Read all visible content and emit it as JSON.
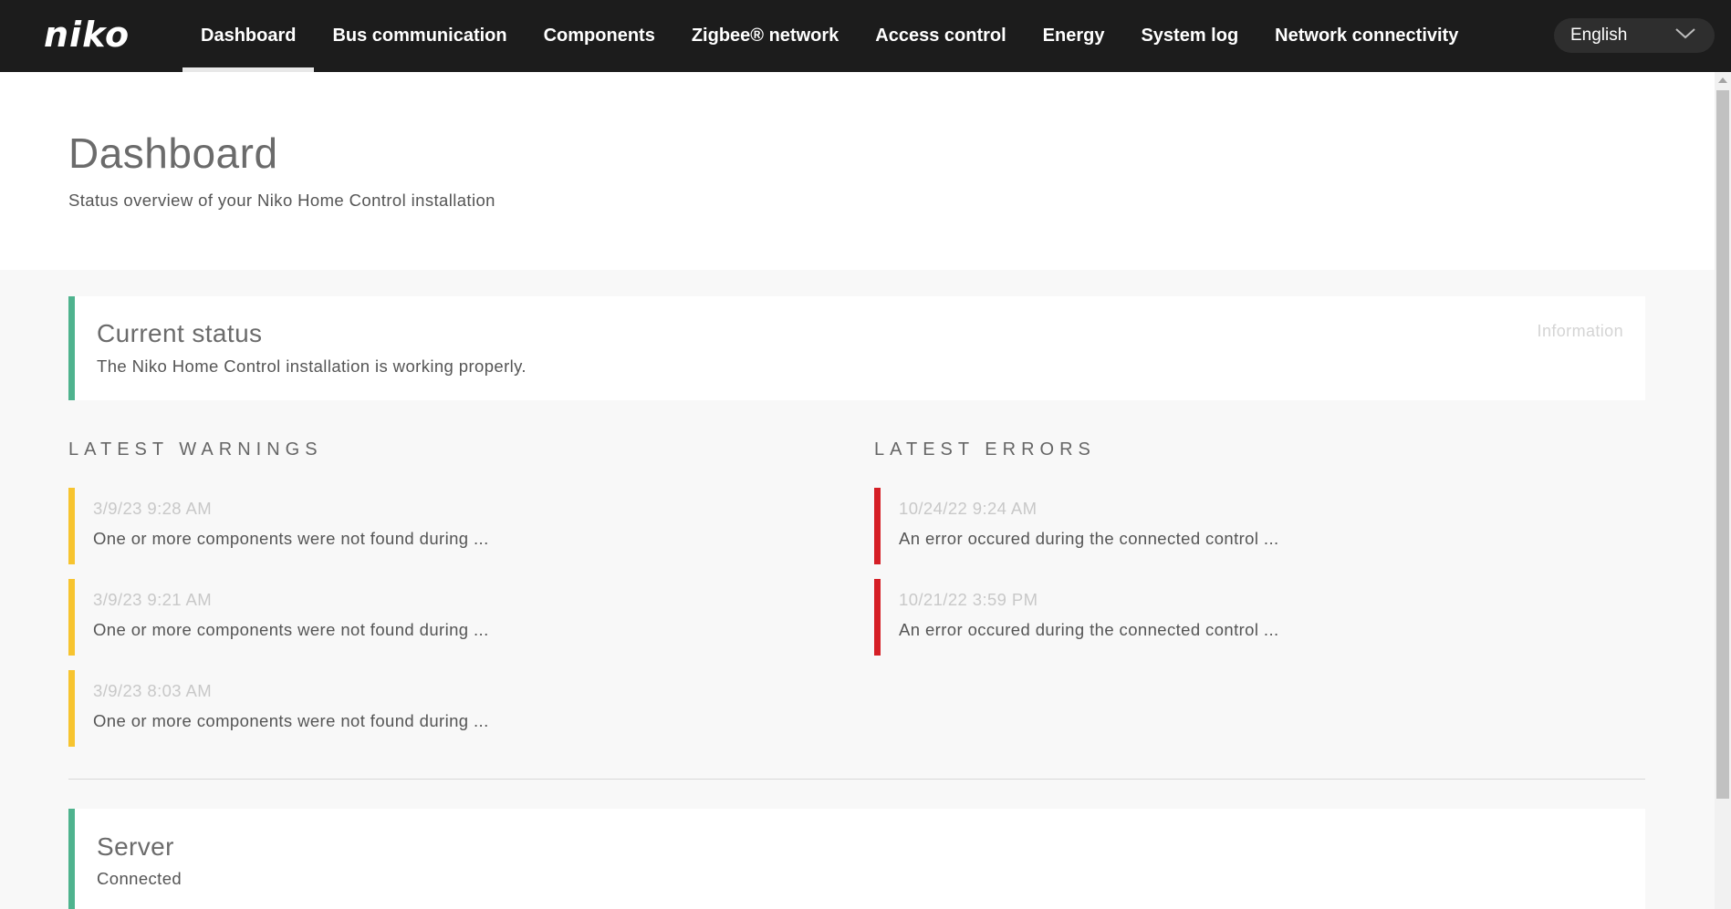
{
  "brand": {
    "logo_text": "niko"
  },
  "nav": {
    "items": [
      {
        "label": "Dashboard",
        "name": "nav-dashboard",
        "active": true
      },
      {
        "label": "Bus communication",
        "name": "nav-bus-communication"
      },
      {
        "label": "Components",
        "name": "nav-components"
      },
      {
        "label": "Zigbee® network",
        "name": "nav-zigbee-network"
      },
      {
        "label": "Access control",
        "name": "nav-access-control"
      },
      {
        "label": "Energy",
        "name": "nav-energy"
      },
      {
        "label": "System log",
        "name": "nav-system-log"
      },
      {
        "label": "Network connectivity",
        "name": "nav-network-connectivity"
      }
    ]
  },
  "language": {
    "selected": "English",
    "icon": "chevron-down-icon"
  },
  "header": {
    "title": "Dashboard",
    "subtitle": "Status overview of your Niko Home Control installation"
  },
  "current_status": {
    "title": "Current status",
    "message": "The Niko Home Control installation is working properly.",
    "info_label": "Information",
    "accent_color": "#4fb38e"
  },
  "warnings": {
    "title": "LATEST WARNINGS",
    "accent_color": "#f7c42f",
    "items": [
      {
        "date": "3/9/23 9:28 AM",
        "message": "One or more components were not found during ..."
      },
      {
        "date": "3/9/23 9:21 AM",
        "message": "One or more components were not found during ..."
      },
      {
        "date": "3/9/23 8:03 AM",
        "message": "One or more components were not found during ..."
      }
    ]
  },
  "errors": {
    "title": "LATEST ERRORS",
    "accent_color": "#d51f26",
    "items": [
      {
        "date": "10/24/22 9:24 AM",
        "message": "An error occured during the connected control ..."
      },
      {
        "date": "10/21/22 3:59 PM",
        "message": "An error occured during the connected control ..."
      }
    ]
  },
  "server": {
    "title": "Server",
    "status": "Connected",
    "accent_color": "#4fb38e"
  }
}
